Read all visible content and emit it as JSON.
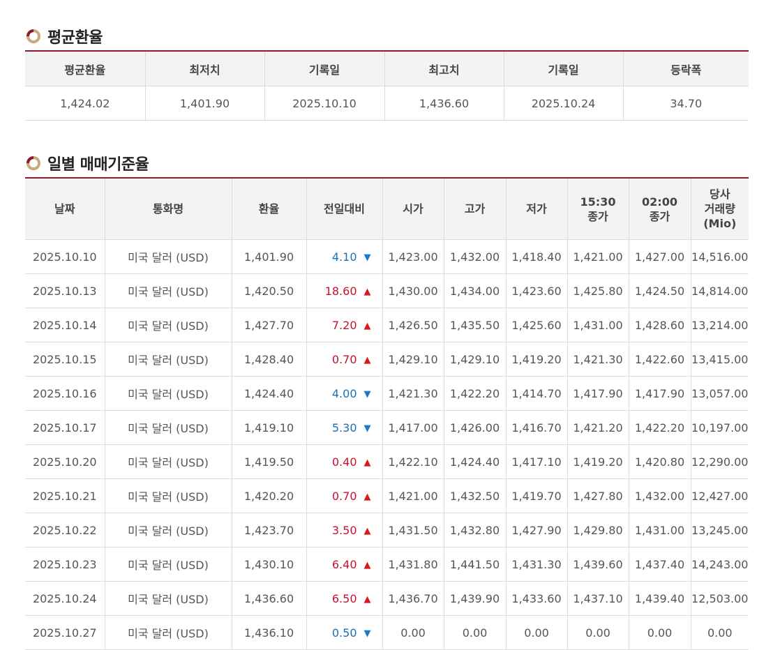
{
  "avg_section": {
    "title": "평균환율",
    "headers": [
      "평균환율",
      "최저치",
      "기록일",
      "최고치",
      "기록일",
      "등락폭"
    ],
    "values": [
      "1,424.02",
      "1,401.90",
      "2025.10.10",
      "1,436.60",
      "2025.10.24",
      "34.70"
    ]
  },
  "daily_section": {
    "title": "일별 매매기준율",
    "headers": {
      "date": "날짜",
      "currency": "통화명",
      "rate": "환율",
      "change": "전일대비",
      "open": "시가",
      "high": "고가",
      "low": "저가",
      "close1530_a": "15:30",
      "close1530_b": "종가",
      "close0200_a": "02:00",
      "close0200_b": "종가",
      "volume_a": "당사",
      "volume_b": "거래량",
      "volume_c": "(Mio)"
    },
    "rows": [
      {
        "date": "2025.10.10",
        "currency": "미국 달러 (USD)",
        "rate": "1,401.90",
        "change": "4.10",
        "dir": "down",
        "arrow": "▼",
        "open": "1,423.00",
        "high": "1,432.00",
        "low": "1,418.40",
        "c1530": "1,421.00",
        "c0200": "1,427.00",
        "vol": "14,516.00"
      },
      {
        "date": "2025.10.13",
        "currency": "미국 달러 (USD)",
        "rate": "1,420.50",
        "change": "18.60",
        "dir": "up",
        "arrow": "▲",
        "open": "1,430.00",
        "high": "1,434.00",
        "low": "1,423.60",
        "c1530": "1,425.80",
        "c0200": "1,424.50",
        "vol": "14,814.00"
      },
      {
        "date": "2025.10.14",
        "currency": "미국 달러 (USD)",
        "rate": "1,427.70",
        "change": "7.20",
        "dir": "up",
        "arrow": "▲",
        "open": "1,426.50",
        "high": "1,435.50",
        "low": "1,425.60",
        "c1530": "1,431.00",
        "c0200": "1,428.60",
        "vol": "13,214.00"
      },
      {
        "date": "2025.10.15",
        "currency": "미국 달러 (USD)",
        "rate": "1,428.40",
        "change": "0.70",
        "dir": "up",
        "arrow": "▲",
        "open": "1,429.10",
        "high": "1,429.10",
        "low": "1,419.20",
        "c1530": "1,421.30",
        "c0200": "1,422.60",
        "vol": "13,415.00"
      },
      {
        "date": "2025.10.16",
        "currency": "미국 달러 (USD)",
        "rate": "1,424.40",
        "change": "4.00",
        "dir": "down",
        "arrow": "▼",
        "open": "1,421.30",
        "high": "1,422.20",
        "low": "1,414.70",
        "c1530": "1,417.90",
        "c0200": "1,417.90",
        "vol": "13,057.00"
      },
      {
        "date": "2025.10.17",
        "currency": "미국 달러 (USD)",
        "rate": "1,419.10",
        "change": "5.30",
        "dir": "down",
        "arrow": "▼",
        "open": "1,417.00",
        "high": "1,426.00",
        "low": "1,416.70",
        "c1530": "1,421.20",
        "c0200": "1,422.20",
        "vol": "10,197.00"
      },
      {
        "date": "2025.10.20",
        "currency": "미국 달러 (USD)",
        "rate": "1,419.50",
        "change": "0.40",
        "dir": "up",
        "arrow": "▲",
        "open": "1,422.10",
        "high": "1,424.40",
        "low": "1,417.10",
        "c1530": "1,419.20",
        "c0200": "1,420.80",
        "vol": "12,290.00"
      },
      {
        "date": "2025.10.21",
        "currency": "미국 달러 (USD)",
        "rate": "1,420.20",
        "change": "0.70",
        "dir": "up",
        "arrow": "▲",
        "open": "1,421.00",
        "high": "1,432.50",
        "low": "1,419.70",
        "c1530": "1,427.80",
        "c0200": "1,432.00",
        "vol": "12,427.00"
      },
      {
        "date": "2025.10.22",
        "currency": "미국 달러 (USD)",
        "rate": "1,423.70",
        "change": "3.50",
        "dir": "up",
        "arrow": "▲",
        "open": "1,431.50",
        "high": "1,432.80",
        "low": "1,427.90",
        "c1530": "1,429.80",
        "c0200": "1,431.00",
        "vol": "13,245.00"
      },
      {
        "date": "2025.10.23",
        "currency": "미국 달러 (USD)",
        "rate": "1,430.10",
        "change": "6.40",
        "dir": "up",
        "arrow": "▲",
        "open": "1,431.80",
        "high": "1,441.50",
        "low": "1,431.30",
        "c1530": "1,439.60",
        "c0200": "1,437.40",
        "vol": "14,243.00"
      },
      {
        "date": "2025.10.24",
        "currency": "미국 달러 (USD)",
        "rate": "1,436.60",
        "change": "6.50",
        "dir": "up",
        "arrow": "▲",
        "open": "1,436.70",
        "high": "1,439.90",
        "low": "1,433.60",
        "c1530": "1,437.10",
        "c0200": "1,439.40",
        "vol": "12,503.00"
      },
      {
        "date": "2025.10.27",
        "currency": "미국 달러 (USD)",
        "rate": "1,436.10",
        "change": "0.50",
        "dir": "down",
        "arrow": "▼",
        "open": "0.00",
        "high": "0.00",
        "low": "0.00",
        "c1530": "0.00",
        "c0200": "0.00",
        "vol": "0.00"
      }
    ]
  },
  "colors": {
    "accent_line": "#8b1a2b",
    "up": "#c8102e",
    "down": "#1a6fb5",
    "header_bg": "#f3f3f3"
  },
  "icons": {
    "section_icon": "ring-bullet-icon"
  }
}
